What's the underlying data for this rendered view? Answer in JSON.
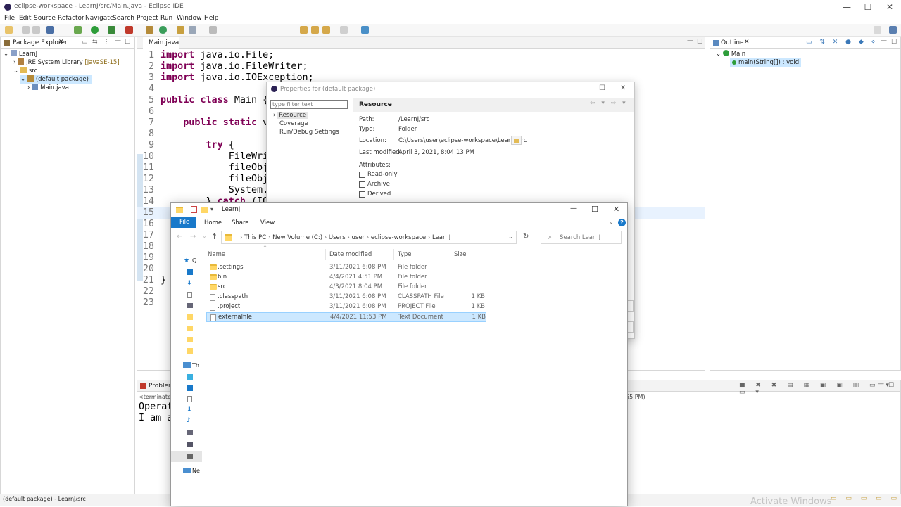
{
  "window": {
    "title": "eclipse-workspace - LearnJ/src/Main.java - Eclipse IDE",
    "min": "—",
    "max": "☐",
    "close": "✕"
  },
  "menu": [
    "File",
    "Edit",
    "Source",
    "Refactor",
    "Navigate",
    "Search",
    "Project",
    "Run",
    "Window",
    "Help"
  ],
  "package_explorer": {
    "tab": "Package Explorer",
    "items": [
      {
        "label": "LearnJ",
        "icon": "project-icon"
      },
      {
        "label": "JRE System Library",
        "extra": "[JavaSE-15]",
        "icon": "library-icon"
      },
      {
        "label": "src",
        "icon": "source-folder-icon"
      },
      {
        "label": "(default package)",
        "icon": "package-icon"
      },
      {
        "label": "Main.java",
        "icon": "java-file-icon"
      }
    ]
  },
  "editor": {
    "tab": "Main.java",
    "lines": [
      {
        "n": "1",
        "code": "import java.io.File;"
      },
      {
        "n": "2",
        "code": "import java.io.FileWriter;"
      },
      {
        "n": "3",
        "code": "import java.io.IOException;"
      },
      {
        "n": "4",
        "code": ""
      },
      {
        "n": "5",
        "code": "public class Main {"
      },
      {
        "n": "6",
        "code": ""
      },
      {
        "n": "7",
        "code": "    public static v"
      },
      {
        "n": "8",
        "code": ""
      },
      {
        "n": "9",
        "code": "        try {"
      },
      {
        "n": "10",
        "code": "            FileWri"
      },
      {
        "n": "11",
        "code": "            fileObj"
      },
      {
        "n": "12",
        "code": "            fileObj"
      },
      {
        "n": "13",
        "code": "            System."
      },
      {
        "n": "14",
        "code": "        } catch (IO"
      },
      {
        "n": "15",
        "code": ""
      },
      {
        "n": "16",
        "code": ""
      },
      {
        "n": "17",
        "code": ""
      },
      {
        "n": "18",
        "code": ""
      },
      {
        "n": "19",
        "code": ""
      },
      {
        "n": "20",
        "code": ""
      },
      {
        "n": "21",
        "code": "}"
      },
      {
        "n": "22",
        "code": ""
      },
      {
        "n": "23",
        "code": ""
      }
    ]
  },
  "outline": {
    "tab": "Outline",
    "class": "Main",
    "method": "main(String[]) : void"
  },
  "console": {
    "tab": "Problems",
    "terminated": "<terminated>",
    "time": "55 PM)",
    "lines": [
      "Operat",
      "I am a"
    ]
  },
  "status": {
    "text": "(default package) - LearnJ/src",
    "watermark": "Activate Windows"
  },
  "properties": {
    "title": "Properties for (default package)",
    "filter_placeholder": "type filter text",
    "nav": [
      "Resource",
      "Coverage",
      "Run/Debug Settings"
    ],
    "heading": "Resource",
    "path_label": "Path:",
    "path": "/LearnJ/src",
    "type_label": "Type:",
    "type": "Folder",
    "location_label": "Location:",
    "location": "C:\\Users\\user\\eclipse-workspace\\LearnJ\\src",
    "modified_label": "Last modified:",
    "modified": "April 3, 2021, 8:04:13 PM",
    "attributes_label": "Attributes:",
    "attributes": [
      "Read-only",
      "Archive",
      "Derived"
    ]
  },
  "explorer": {
    "title": "LearnJ",
    "ribbon": [
      "File",
      "Home",
      "Share",
      "View"
    ],
    "breadcrumb": [
      "This PC",
      "New Volume (C:)",
      "Users",
      "user",
      "eclipse-workspace",
      "LearnJ"
    ],
    "search_placeholder": "Search LearnJ",
    "columns": [
      "Name",
      "Date modified",
      "Type",
      "Size"
    ],
    "rows": [
      {
        "name": ".settings",
        "date": "3/11/2021 6:08 PM",
        "type": "File folder",
        "size": "",
        "kind": "folder"
      },
      {
        "name": "bin",
        "date": "4/4/2021 4:51 PM",
        "type": "File folder",
        "size": "",
        "kind": "folder"
      },
      {
        "name": "src",
        "date": "4/3/2021 8:04 PM",
        "type": "File folder",
        "size": "",
        "kind": "folder"
      },
      {
        "name": ".classpath",
        "date": "3/11/2021 6:08 PM",
        "type": "CLASSPATH File",
        "size": "1 KB",
        "kind": "file"
      },
      {
        "name": ".project",
        "date": "3/11/2021 6:08 PM",
        "type": "PROJECT File",
        "size": "1 KB",
        "kind": "file"
      },
      {
        "name": "externalfile",
        "date": "4/4/2021 11:53 PM",
        "type": "Text Document",
        "size": "1 KB",
        "kind": "file",
        "selected": true
      }
    ],
    "sidebar_label_quick": "Q",
    "sidebar_label_thispc": "Th",
    "sidebar_label_network": "Ne"
  },
  "colors": {
    "accent": "#0063b1",
    "selection": "#cce8ff",
    "folder": "#ffd766",
    "keyword": "#7f0055"
  }
}
